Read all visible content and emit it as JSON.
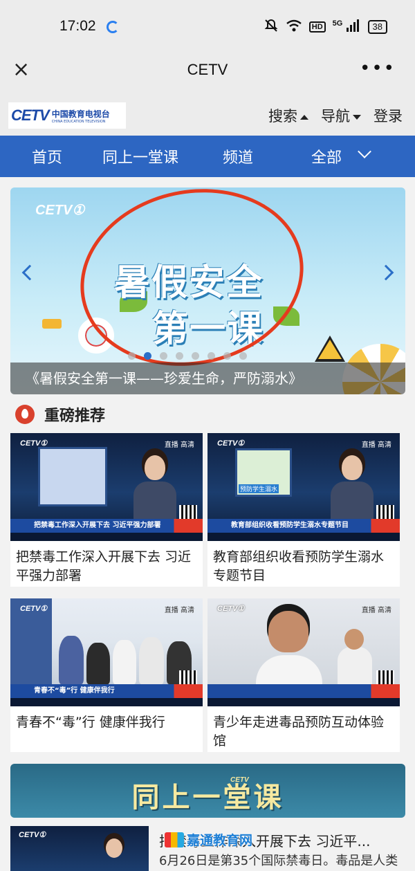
{
  "status": {
    "time": "17:02",
    "hd": "HD",
    "network": "5G",
    "battery": "38"
  },
  "titlebar": {
    "close_icon": "×",
    "title": "CETV",
    "more_icon": "•••"
  },
  "site": {
    "logo_text": "CETV",
    "logo_cn": "中国教育电视台",
    "logo_en": "CHINA EDUCATION TELEVISION",
    "nav": [
      "搜索",
      "导航",
      "登录"
    ]
  },
  "bluenav": {
    "items": [
      "首页",
      "同上一堂课",
      "频道",
      "全部"
    ]
  },
  "banner": {
    "channel_tag": "CETV①",
    "headline1": "暑假安全",
    "headline2": "第一课",
    "caption": "《暑假安全第一课——珍爱生命，严防溺水》",
    "slide_count": 8,
    "active_slide": 2
  },
  "section": {
    "title": "重磅推荐"
  },
  "cards": [
    {
      "title": "把禁毒工作深入开展下去 习近平强力部署",
      "thumb_channel": "CETV①",
      "thumb_live": "直播 高清",
      "thumb_caption": "把禁毒工作深入开展下去 习近平强力部署"
    },
    {
      "title": "教育部组织收看预防学生溺水专题节目",
      "thumb_channel": "CETV①",
      "thumb_live": "直播 高清",
      "thumb_caption": "教育部组织收看预防学生溺水专题节目",
      "thumb_screen_text": "预防学生溺水"
    },
    {
      "title": "青春不“毒”行 健康伴我行",
      "thumb_channel": "CETV①",
      "thumb_live": "直播 高清",
      "thumb_caption": "青春不“毒”行 健康伴我行"
    },
    {
      "title": "青少年走进毒品预防互动体验馆",
      "thumb_channel": "CETV①",
      "thumb_live": "直播 高清"
    }
  ],
  "banner2": {
    "title": "同上一堂课",
    "logo": "CETV"
  },
  "list": [
    {
      "title": "把禁毒工作深入开展下去 习近平...",
      "desc": "6月26日是第35个国际禁毒日。毒品是人类"
    }
  ],
  "watermark": {
    "text": "嘉通教育网"
  },
  "colors": {
    "nav_blue": "#2d66c2",
    "fire_red": "#d9412d",
    "circle_red": "#e53b1e"
  }
}
